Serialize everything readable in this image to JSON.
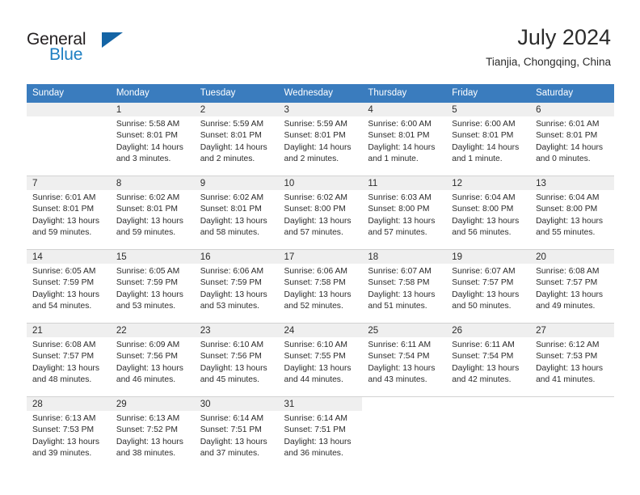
{
  "brand": {
    "name_top": "General",
    "name_bottom": "Blue",
    "triangle_color": "#1464a5",
    "blue_color": "#1e7fc2"
  },
  "header": {
    "title": "July 2024",
    "location": "Tianjia, Chongqing, China",
    "header_bg": "#3a7cbe",
    "daynum_bg": "#efefef"
  },
  "weekday_headers": [
    "Sunday",
    "Monday",
    "Tuesday",
    "Wednesday",
    "Thursday",
    "Friday",
    "Saturday"
  ],
  "labels": {
    "sunrise_prefix": "Sunrise:",
    "sunset_prefix": "Sunset:",
    "daylight_prefix": "Daylight:"
  },
  "weeks": [
    [
      {
        "day": "",
        "empty": true,
        "line1": "",
        "line2": "",
        "line3": "",
        "line4": ""
      },
      {
        "day": "1",
        "line1": "Sunrise: 5:58 AM",
        "line2": "Sunset: 8:01 PM",
        "line3": "Daylight: 14 hours",
        "line4": "and 3 minutes."
      },
      {
        "day": "2",
        "line1": "Sunrise: 5:59 AM",
        "line2": "Sunset: 8:01 PM",
        "line3": "Daylight: 14 hours",
        "line4": "and 2 minutes."
      },
      {
        "day": "3",
        "line1": "Sunrise: 5:59 AM",
        "line2": "Sunset: 8:01 PM",
        "line3": "Daylight: 14 hours",
        "line4": "and 2 minutes."
      },
      {
        "day": "4",
        "line1": "Sunrise: 6:00 AM",
        "line2": "Sunset: 8:01 PM",
        "line3": "Daylight: 14 hours",
        "line4": "and 1 minute."
      },
      {
        "day": "5",
        "line1": "Sunrise: 6:00 AM",
        "line2": "Sunset: 8:01 PM",
        "line3": "Daylight: 14 hours",
        "line4": "and 1 minute."
      },
      {
        "day": "6",
        "line1": "Sunrise: 6:01 AM",
        "line2": "Sunset: 8:01 PM",
        "line3": "Daylight: 14 hours",
        "line4": "and 0 minutes."
      }
    ],
    [
      {
        "day": "7",
        "line1": "Sunrise: 6:01 AM",
        "line2": "Sunset: 8:01 PM",
        "line3": "Daylight: 13 hours",
        "line4": "and 59 minutes."
      },
      {
        "day": "8",
        "line1": "Sunrise: 6:02 AM",
        "line2": "Sunset: 8:01 PM",
        "line3": "Daylight: 13 hours",
        "line4": "and 59 minutes."
      },
      {
        "day": "9",
        "line1": "Sunrise: 6:02 AM",
        "line2": "Sunset: 8:01 PM",
        "line3": "Daylight: 13 hours",
        "line4": "and 58 minutes."
      },
      {
        "day": "10",
        "line1": "Sunrise: 6:02 AM",
        "line2": "Sunset: 8:00 PM",
        "line3": "Daylight: 13 hours",
        "line4": "and 57 minutes."
      },
      {
        "day": "11",
        "line1": "Sunrise: 6:03 AM",
        "line2": "Sunset: 8:00 PM",
        "line3": "Daylight: 13 hours",
        "line4": "and 57 minutes."
      },
      {
        "day": "12",
        "line1": "Sunrise: 6:04 AM",
        "line2": "Sunset: 8:00 PM",
        "line3": "Daylight: 13 hours",
        "line4": "and 56 minutes."
      },
      {
        "day": "13",
        "line1": "Sunrise: 6:04 AM",
        "line2": "Sunset: 8:00 PM",
        "line3": "Daylight: 13 hours",
        "line4": "and 55 minutes."
      }
    ],
    [
      {
        "day": "14",
        "line1": "Sunrise: 6:05 AM",
        "line2": "Sunset: 7:59 PM",
        "line3": "Daylight: 13 hours",
        "line4": "and 54 minutes."
      },
      {
        "day": "15",
        "line1": "Sunrise: 6:05 AM",
        "line2": "Sunset: 7:59 PM",
        "line3": "Daylight: 13 hours",
        "line4": "and 53 minutes."
      },
      {
        "day": "16",
        "line1": "Sunrise: 6:06 AM",
        "line2": "Sunset: 7:59 PM",
        "line3": "Daylight: 13 hours",
        "line4": "and 53 minutes."
      },
      {
        "day": "17",
        "line1": "Sunrise: 6:06 AM",
        "line2": "Sunset: 7:58 PM",
        "line3": "Daylight: 13 hours",
        "line4": "and 52 minutes."
      },
      {
        "day": "18",
        "line1": "Sunrise: 6:07 AM",
        "line2": "Sunset: 7:58 PM",
        "line3": "Daylight: 13 hours",
        "line4": "and 51 minutes."
      },
      {
        "day": "19",
        "line1": "Sunrise: 6:07 AM",
        "line2": "Sunset: 7:57 PM",
        "line3": "Daylight: 13 hours",
        "line4": "and 50 minutes."
      },
      {
        "day": "20",
        "line1": "Sunrise: 6:08 AM",
        "line2": "Sunset: 7:57 PM",
        "line3": "Daylight: 13 hours",
        "line4": "and 49 minutes."
      }
    ],
    [
      {
        "day": "21",
        "line1": "Sunrise: 6:08 AM",
        "line2": "Sunset: 7:57 PM",
        "line3": "Daylight: 13 hours",
        "line4": "and 48 minutes."
      },
      {
        "day": "22",
        "line1": "Sunrise: 6:09 AM",
        "line2": "Sunset: 7:56 PM",
        "line3": "Daylight: 13 hours",
        "line4": "and 46 minutes."
      },
      {
        "day": "23",
        "line1": "Sunrise: 6:10 AM",
        "line2": "Sunset: 7:56 PM",
        "line3": "Daylight: 13 hours",
        "line4": "and 45 minutes."
      },
      {
        "day": "24",
        "line1": "Sunrise: 6:10 AM",
        "line2": "Sunset: 7:55 PM",
        "line3": "Daylight: 13 hours",
        "line4": "and 44 minutes."
      },
      {
        "day": "25",
        "line1": "Sunrise: 6:11 AM",
        "line2": "Sunset: 7:54 PM",
        "line3": "Daylight: 13 hours",
        "line4": "and 43 minutes."
      },
      {
        "day": "26",
        "line1": "Sunrise: 6:11 AM",
        "line2": "Sunset: 7:54 PM",
        "line3": "Daylight: 13 hours",
        "line4": "and 42 minutes."
      },
      {
        "day": "27",
        "line1": "Sunrise: 6:12 AM",
        "line2": "Sunset: 7:53 PM",
        "line3": "Daylight: 13 hours",
        "line4": "and 41 minutes."
      }
    ],
    [
      {
        "day": "28",
        "line1": "Sunrise: 6:13 AM",
        "line2": "Sunset: 7:53 PM",
        "line3": "Daylight: 13 hours",
        "line4": "and 39 minutes."
      },
      {
        "day": "29",
        "line1": "Sunrise: 6:13 AM",
        "line2": "Sunset: 7:52 PM",
        "line3": "Daylight: 13 hours",
        "line4": "and 38 minutes."
      },
      {
        "day": "30",
        "line1": "Sunrise: 6:14 AM",
        "line2": "Sunset: 7:51 PM",
        "line3": "Daylight: 13 hours",
        "line4": "and 37 minutes."
      },
      {
        "day": "31",
        "line1": "Sunrise: 6:14 AM",
        "line2": "Sunset: 7:51 PM",
        "line3": "Daylight: 13 hours",
        "line4": "and 36 minutes."
      },
      {
        "day": "",
        "blank": true,
        "line1": "",
        "line2": "",
        "line3": "",
        "line4": ""
      },
      {
        "day": "",
        "blank": true,
        "line1": "",
        "line2": "",
        "line3": "",
        "line4": ""
      },
      {
        "day": "",
        "blank": true,
        "line1": "",
        "line2": "",
        "line3": "",
        "line4": ""
      }
    ]
  ]
}
